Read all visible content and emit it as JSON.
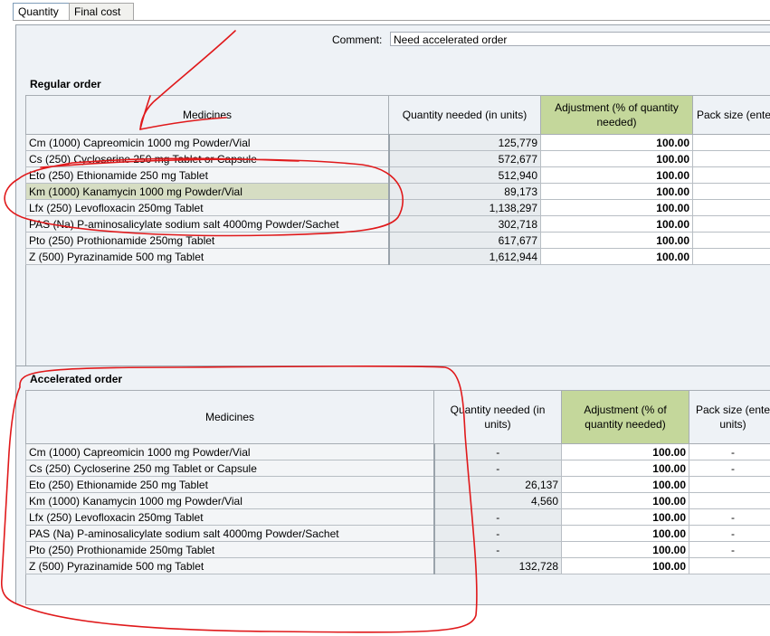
{
  "tabs": [
    {
      "label": "Quantity",
      "active": true
    },
    {
      "label": "Final cost",
      "active": false
    }
  ],
  "comment": {
    "label": "Comment:",
    "value": "Need accelerated order"
  },
  "regular": {
    "title": "Regular order",
    "headers": {
      "medicines": "Medicines",
      "qty": "Quantity needed (in units)",
      "adj": "Adjustment (% of quantity needed)",
      "pack": "Pack size (ente"
    },
    "rows": [
      {
        "name": "Cm (1000)  Capreomicin  1000 mg  Powder/Vial",
        "qty": "125,779",
        "adj": "100.00",
        "pack": ""
      },
      {
        "name": "Cs (250)  Cycloserine  250 mg  Tablet or Capsule",
        "qty": "572,677",
        "adj": "100.00",
        "pack": ""
      },
      {
        "name": "Eto (250)  Ethionamide  250 mg  Tablet",
        "qty": "512,940",
        "adj": "100.00",
        "pack": ""
      },
      {
        "name": "Km (1000)  Kanamycin  1000 mg  Powder/Vial",
        "qty": "89,173",
        "adj": "100.00",
        "pack": ""
      },
      {
        "name": "Lfx (250)  Levofloxacin  250mg  Tablet",
        "qty": "1,138,297",
        "adj": "100.00",
        "pack": ""
      },
      {
        "name": "PAS (Na)  P-aminosalicylate sodium salt  4000mg  Powder/Sachet",
        "qty": "302,718",
        "adj": "100.00",
        "pack": ""
      },
      {
        "name": "Pto (250)  Prothionamide   250mg  Tablet",
        "qty": "617,677",
        "adj": "100.00",
        "pack": ""
      },
      {
        "name": "Z (500)  Pyrazinamide  500 mg  Tablet",
        "qty": "1,612,944",
        "adj": "100.00",
        "pack": ""
      }
    ]
  },
  "accelerated": {
    "title": "Accelerated order",
    "headers": {
      "medicines": "Medicines",
      "qty": "Quantity needed (in units)",
      "adj": "Adjustment (% of quantity needed)",
      "pack": "Pack size (ente units)"
    },
    "rows": [
      {
        "name": "Cm (1000)  Capreomicin  1000 mg  Powder/Vial",
        "qty": "-",
        "adj": "100.00",
        "pack": "-"
      },
      {
        "name": "Cs (250)  Cycloserine  250 mg  Tablet or Capsule",
        "qty": "-",
        "adj": "100.00",
        "pack": "-"
      },
      {
        "name": "Eto (250)  Ethionamide  250 mg  Tablet",
        "qty": "26,137",
        "adj": "100.00",
        "pack": ""
      },
      {
        "name": "Km (1000)  Kanamycin  1000 mg  Powder/Vial",
        "qty": "4,560",
        "adj": "100.00",
        "pack": ""
      },
      {
        "name": "Lfx (250)  Levofloxacin  250mg  Tablet",
        "qty": "-",
        "adj": "100.00",
        "pack": "-"
      },
      {
        "name": "PAS (Na)  P-aminosalicylate sodium salt  4000mg  Powder/Sachet",
        "qty": "-",
        "adj": "100.00",
        "pack": "-"
      },
      {
        "name": "Pto (250)  Prothionamide   250mg  Tablet",
        "qty": "-",
        "adj": "100.00",
        "pack": "-"
      },
      {
        "name": "Z (500)  Pyrazinamide  500 mg  Tablet",
        "qty": "132,728",
        "adj": "100.00",
        "pack": ""
      }
    ]
  },
  "colors": {
    "adjustment_header": "#c4d79b",
    "selected_row": "#d6ddc3",
    "annotation": "#e0191b"
  }
}
